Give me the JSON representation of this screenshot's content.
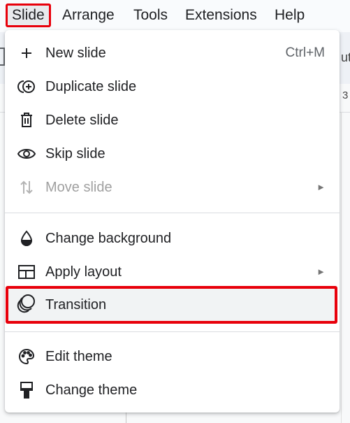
{
  "menubar": {
    "items": [
      {
        "label": "Slide"
      },
      {
        "label": "Arrange"
      },
      {
        "label": "Tools"
      },
      {
        "label": "Extensions"
      },
      {
        "label": "Help"
      }
    ]
  },
  "background": {
    "toolbar_peek_text": "ut",
    "ruler_peek_text": "3"
  },
  "slide_menu": {
    "items": [
      {
        "label": "New slide",
        "shortcut": "Ctrl+M",
        "icon": "plus-icon"
      },
      {
        "label": "Duplicate slide",
        "icon": "duplicate-icon"
      },
      {
        "label": "Delete slide",
        "icon": "trash-icon"
      },
      {
        "label": "Skip slide",
        "icon": "eye-icon"
      },
      {
        "label": "Move slide",
        "icon": "move-arrows-icon",
        "disabled": true,
        "submenu": true
      },
      {
        "label": "Change background",
        "icon": "droplet-icon"
      },
      {
        "label": "Apply layout",
        "icon": "layout-icon",
        "submenu": true
      },
      {
        "label": "Transition",
        "icon": "transition-icon",
        "highlighted": true
      },
      {
        "label": "Edit theme",
        "icon": "palette-icon"
      },
      {
        "label": "Change theme",
        "icon": "paint-roller-icon"
      }
    ],
    "submenu_arrow": "►"
  },
  "colors": {
    "highlight_border": "#e8000b",
    "menu_background": "#ffffff",
    "text": "#202124",
    "disabled_text": "#a0a0a0"
  }
}
